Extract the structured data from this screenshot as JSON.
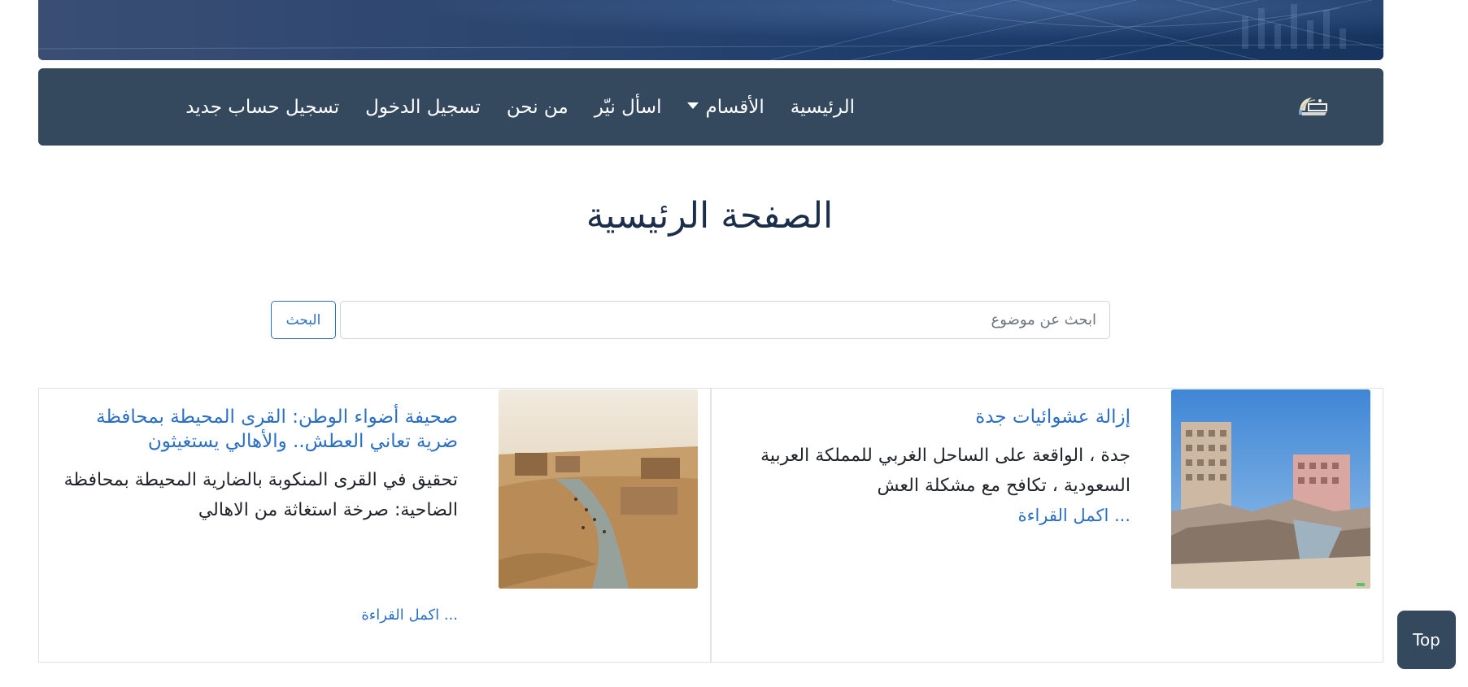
{
  "nav": {
    "items": [
      {
        "label": "الرئيسية"
      },
      {
        "label": "الأقسام"
      },
      {
        "label": "اسأل نيّر"
      },
      {
        "label": "من نحن"
      },
      {
        "label": "تسجيل الدخول"
      },
      {
        "label": "تسجيل حساب جديد"
      }
    ]
  },
  "page": {
    "title": "الصفحة الرئيسية"
  },
  "search": {
    "placeholder": "ابحث عن موضوع",
    "button_label": "البحث"
  },
  "articles": [
    {
      "title": "إزالة عشوائيات جدة",
      "excerpt": "جدة ، الواقعة على الساحل الغربي للمملكة العربية السعودية ، تكافح مع مشكلة العش",
      "read_more": "... اكمل القراءة"
    },
    {
      "title": "صحيفة أضواء الوطن: القرى المحيطة بمحافظة ضرية تعاني العطش.. والأهالي يستغيثون",
      "excerpt": "تحقيق في القرى المنكوبة بالضارية المحيطة بمحافظة الضاحية: صرخة استغاثة من الاهالي",
      "read_more": "... اكمل القراءة"
    }
  ],
  "top_button": {
    "label": "Top"
  },
  "colors": {
    "navbar": "#34495e",
    "link": "#2a6fc4",
    "title": "#1c2f4a"
  }
}
